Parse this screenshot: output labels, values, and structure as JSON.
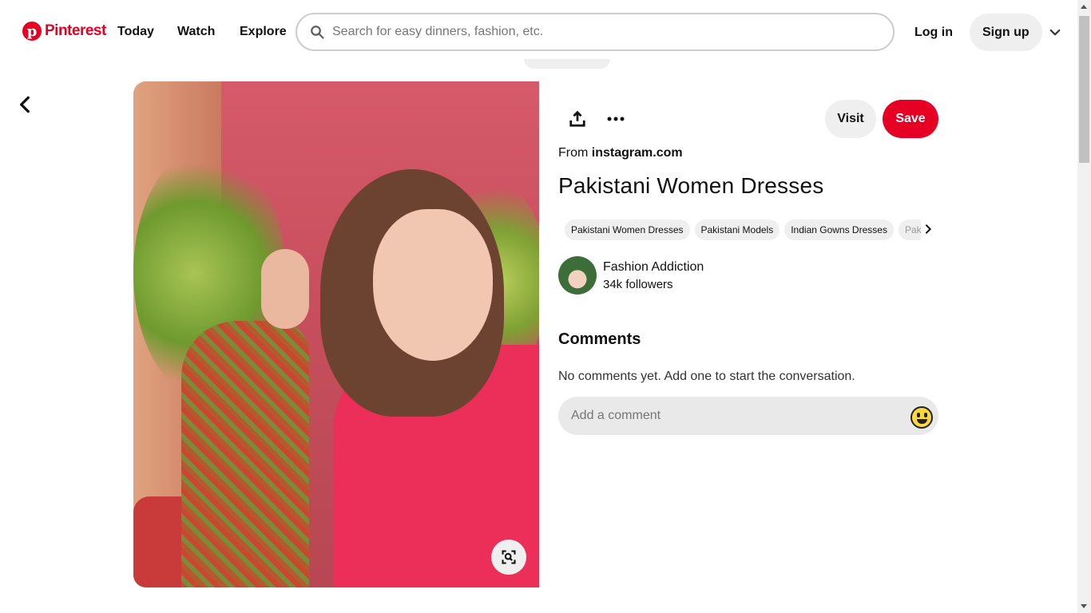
{
  "header": {
    "brand": "Pinterest",
    "nav": [
      "Today",
      "Watch",
      "Explore"
    ],
    "search_placeholder": "Search for easy dinners, fashion, etc.",
    "login_label": "Log in",
    "signup_label": "Sign up"
  },
  "pin": {
    "visit_label": "Visit",
    "save_label": "Save",
    "from_prefix": "From",
    "from_domain": "instagram.com",
    "title": "Pakistani Women Dresses",
    "tags": [
      "Pakistani Women Dresses",
      "Pakistani Models",
      "Indian Gowns Dresses",
      "Pakis"
    ],
    "creator": {
      "name": "Fashion Addiction",
      "followers": "34k followers"
    }
  },
  "comments": {
    "heading": "Comments",
    "empty_text": "No comments yet. Add one to start the conversation.",
    "input_placeholder": "Add a comment"
  },
  "colors": {
    "brand": "#e60023",
    "chip_bg": "#efefef"
  }
}
